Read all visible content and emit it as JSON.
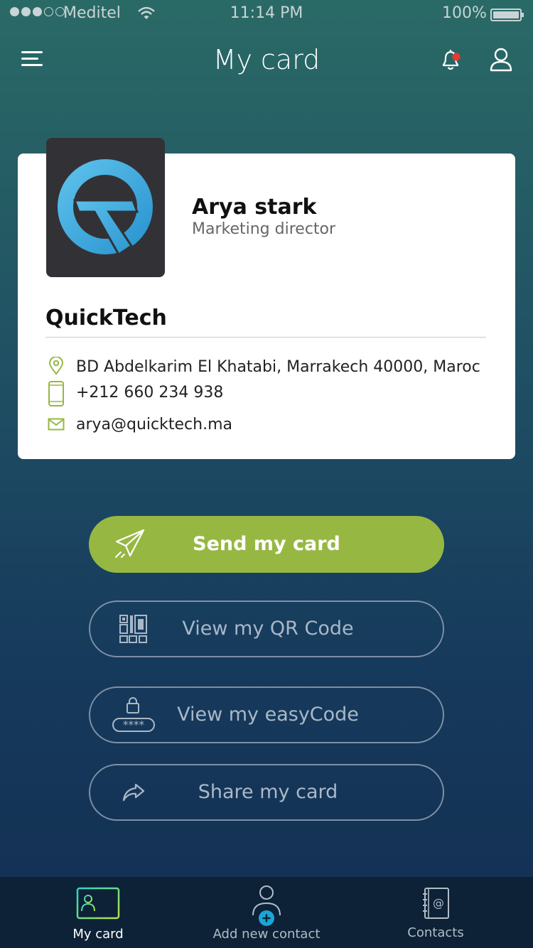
{
  "status_bar": {
    "carrier": "Meditel",
    "time": "11:14 PM",
    "battery": "100%"
  },
  "header": {
    "title": "My card"
  },
  "card": {
    "name": "Arya stark",
    "role": "Marketing director",
    "company": "QuickTech",
    "address": "BD Abdelkarim El Khatabi, Marrakech 40000, Maroc",
    "phone": "+212 660 234 938",
    "email": "arya@quicktech.ma"
  },
  "actions": {
    "send": "Send my card",
    "qr": "View my QR Code",
    "easycode": "View my easyCode",
    "share": "Share my card"
  },
  "tabs": [
    {
      "label": "My card",
      "icon": "id-card-icon",
      "active": true
    },
    {
      "label": "Add  new contact",
      "icon": "add-contact-icon",
      "active": false
    },
    {
      "label": "Contacts",
      "icon": "address-book-icon",
      "active": false
    }
  ],
  "colors": {
    "accent_green": "#96b843",
    "notification_dot": "#e8392f",
    "active_tab": "#2bd4c7",
    "add_badge": "#1aa6d6"
  }
}
